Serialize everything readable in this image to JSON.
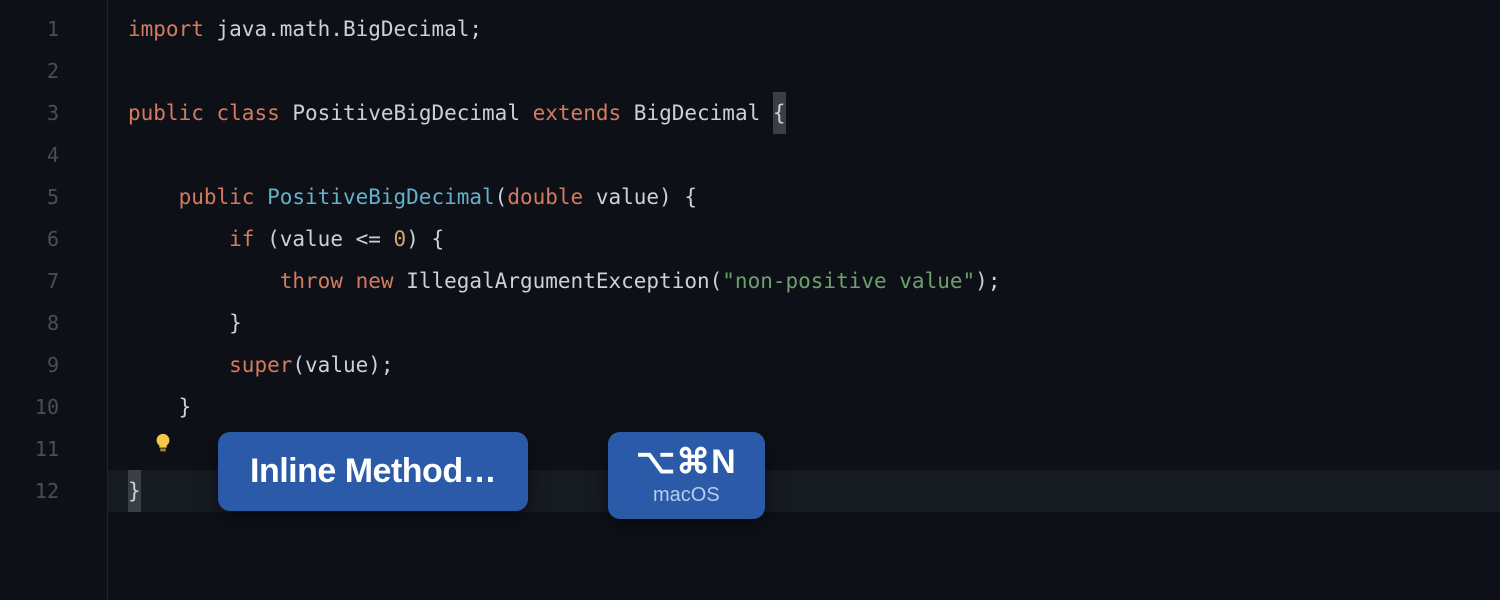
{
  "lines": [
    "1",
    "2",
    "3",
    "4",
    "5",
    "6",
    "7",
    "8",
    "9",
    "10",
    "11",
    "12"
  ],
  "code": {
    "l1": {
      "import": "import",
      "pkg": "java.math.BigDecimal",
      "semi": ";"
    },
    "l3": {
      "public": "public",
      "class": "class",
      "name": "PositiveBigDecimal",
      "extends": "extends",
      "base": "BigDecimal",
      "brace": "{"
    },
    "l5": {
      "indent": "    ",
      "public": "public",
      "ctor": "PositiveBigDecimal",
      "lp": "(",
      "ptype": "double",
      "pname": " value",
      "rp": ")",
      "brace": " {"
    },
    "l6": {
      "indent": "        ",
      "if": "if",
      "lp": " (",
      "var": "value",
      "op": " <= ",
      "zero": "0",
      "rp": ")",
      "brace": " {"
    },
    "l7": {
      "indent": "            ",
      "throw": "throw",
      "new": "new",
      "exc": "IllegalArgumentException",
      "lp": "(",
      "str": "\"non-positive value\"",
      "rp": ")",
      "semi": ";"
    },
    "l8": {
      "indent": "        ",
      "brace": "}"
    },
    "l9": {
      "indent": "        ",
      "super": "super",
      "lp": "(",
      "arg": "value",
      "rp": ")",
      "semi": ";"
    },
    "l10": {
      "indent": "    ",
      "brace": "}"
    },
    "l12": {
      "brace": "}"
    }
  },
  "action": {
    "label": "Inline Method…"
  },
  "shortcut": {
    "keys": "⌥⌘N",
    "platform": "macOS"
  },
  "bulb": {
    "name": "lightbulb-icon"
  }
}
